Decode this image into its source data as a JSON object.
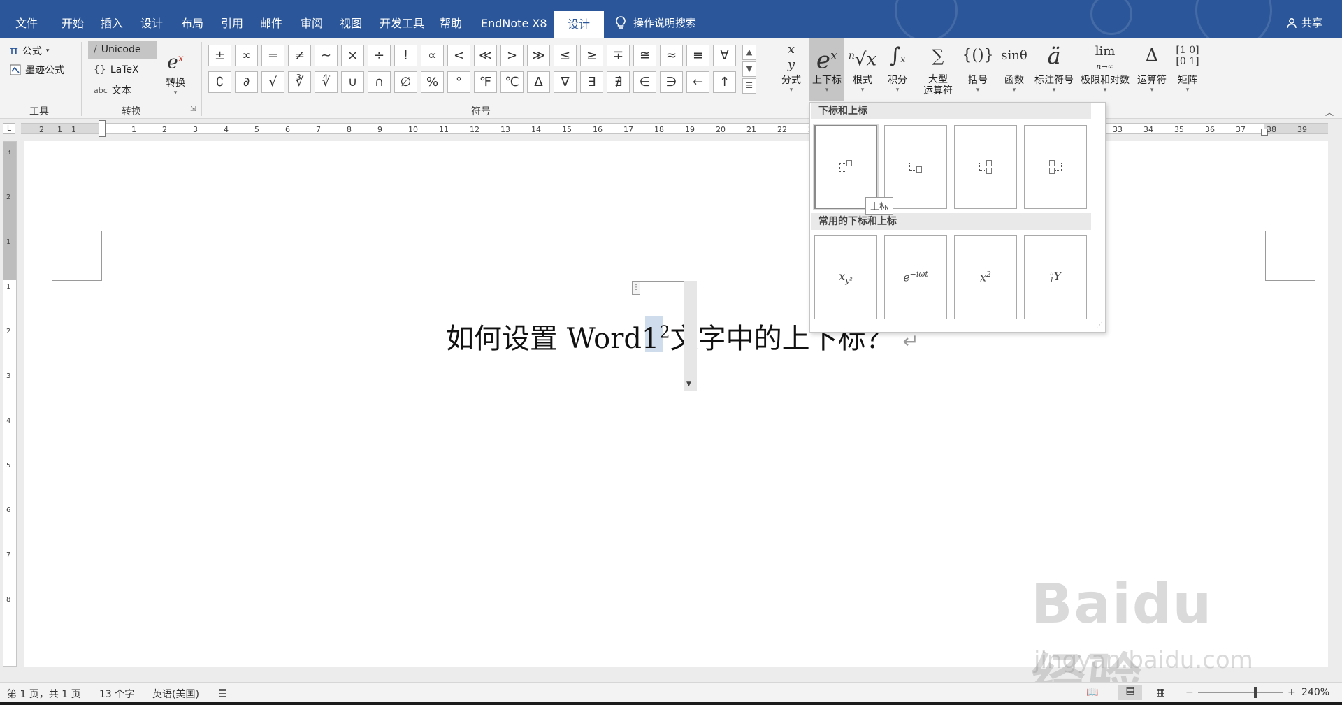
{
  "menubar": {
    "tabs": [
      "文件",
      "开始",
      "插入",
      "设计",
      "布局",
      "引用",
      "邮件",
      "审阅",
      "视图",
      "开发工具",
      "帮助",
      "EndNote X8",
      "设计"
    ],
    "tell_me": "操作说明搜索",
    "share": "共享",
    "background": "#2b579a"
  },
  "ribbon": {
    "tools": {
      "formula": "公式",
      "ink_formula": "墨迹公式",
      "group": "工具"
    },
    "convert": {
      "unicode": "Unicode",
      "latex": "LaTeX",
      "text": "文本",
      "convert_btn": "转换",
      "group": "转换"
    },
    "symbols": {
      "group": "符号",
      "row1": [
        "±",
        "∞",
        "=",
        "≠",
        "~",
        "×",
        "÷",
        "!",
        "∝",
        "<",
        "≪",
        ">",
        "≫",
        "≤",
        "≥",
        "∓",
        "≅",
        "≈",
        "≡",
        "∀"
      ],
      "row2": [
        "∁",
        "∂",
        "√",
        "∛",
        "∜",
        "∪",
        "∩",
        "∅",
        "%",
        "°",
        "℉",
        "℃",
        "∆",
        "∇",
        "∃",
        "∄",
        "∈",
        "∋",
        "←",
        "↑"
      ]
    },
    "structures": [
      {
        "label": "分式",
        "glyph": "x/y"
      },
      {
        "label": "上下标",
        "glyph": "eˣ"
      },
      {
        "label": "根式",
        "glyph": "ⁿ√x"
      },
      {
        "label": "积分",
        "glyph": "∫"
      },
      {
        "label": "大型\n运算符",
        "glyph": "∑"
      },
      {
        "label": "括号",
        "glyph": "{()}"
      },
      {
        "label": "函数",
        "glyph": "sinθ"
      },
      {
        "label": "标注符号",
        "glyph": "ä"
      },
      {
        "label": "极限和对数",
        "glyph": "lim"
      },
      {
        "label": "运算符",
        "glyph": "∆"
      },
      {
        "label": "矩阵",
        "glyph": "[10;01]"
      }
    ]
  },
  "ruler": {
    "corner": "L",
    "left_numbers": [
      "2",
      "1",
      "1"
    ],
    "numbers": [
      "1",
      "2",
      "3",
      "4",
      "5",
      "6",
      "7",
      "8",
      "9",
      "10",
      "11",
      "12",
      "13",
      "14",
      "15",
      "16",
      "17",
      "18",
      "19",
      "20",
      "21",
      "22",
      "2"
    ],
    "right_numbers": [
      "33",
      "34",
      "35",
      "36",
      "37",
      "38",
      "39"
    ],
    "vertical_numbers": [
      "3",
      "2",
      "1",
      "1",
      "2",
      "3",
      "4",
      "5",
      "6",
      "7",
      "8"
    ]
  },
  "document": {
    "before": "如何设置 Word",
    "eq_base": "1",
    "eq_sup": "2",
    "after": "文字中的上下标？",
    "para_mark": "↵"
  },
  "dropdown": {
    "section1": "下标和上标",
    "section2": "常用的下标和上标",
    "tooltip": "上标",
    "common": [
      "x_{y²}",
      "e^{−iωt}",
      "x²",
      "ⁿ₁Y"
    ]
  },
  "status": {
    "page": "第 1 页，共 1 页",
    "words": "13 个字",
    "language": "英语(美国)",
    "zoom": "240%",
    "zoom_minus": "−",
    "zoom_plus": "+"
  },
  "watermark": {
    "logo": "Baidu 经验",
    "url": "jingyan.baidu.com"
  }
}
